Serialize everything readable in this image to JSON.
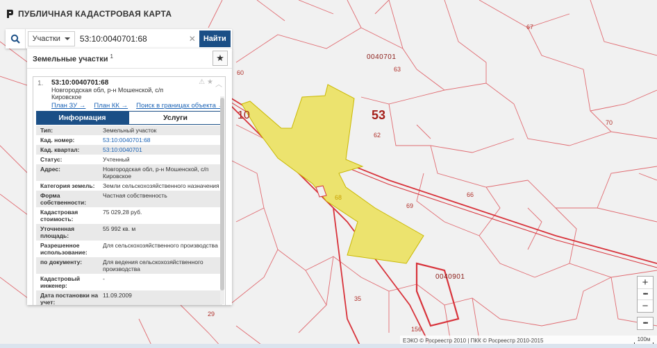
{
  "app": {
    "title": "ПУБЛИЧНАЯ КАДАСТРОВАЯ КАРТА"
  },
  "search": {
    "type_label": "Участки",
    "query": "53:10:0040701:68",
    "find_label": "Найти"
  },
  "panel": {
    "title": "Земельные участки",
    "count": "1",
    "item": {
      "index": "1.",
      "cadastral_number": "53:10:0040701:68",
      "address": "Новгородская обл, р-н Мошенской, с/п Кировское",
      "links": [
        "План ЗУ →",
        "План КК →",
        "Поиск в границах объекта →"
      ],
      "tabs": [
        "Информация",
        "Услуги"
      ],
      "rows": [
        {
          "k": "Тип:",
          "v": "Земельный участок"
        },
        {
          "k": "Кад. номер:",
          "v": "53:10:0040701:68"
        },
        {
          "k": "Кад. квартал:",
          "v": "53:10:0040701"
        },
        {
          "k": "Статус:",
          "v": "Учтенный"
        },
        {
          "k": "Адрес:",
          "v": "Новгородская обл, р-н Мошенской, с/п Кировское"
        },
        {
          "k": "Категория земель:",
          "v": "Земли сельскохозяйственного назначения"
        },
        {
          "k": "Форма собственности:",
          "v": "Частная собственность"
        },
        {
          "k": "Кадастровая стоимость:",
          "v": "75 029,28 руб."
        },
        {
          "k": "Уточненная площадь:",
          "v": "55 992 кв. м"
        },
        {
          "k": "Разрешенное использование:",
          "v": "Для сельскохозяйственного производства"
        },
        {
          "k": "по документу:",
          "v": "Для ведения сельскохозяйственного производства"
        },
        {
          "k": "Кадастровый инженер:",
          "v": "-"
        },
        {
          "k": "Дата постановки на учет:",
          "v": "11.09.2009"
        }
      ]
    }
  },
  "map": {
    "labels": [
      {
        "t": "0040701",
        "c": "zone"
      },
      {
        "t": "0040901",
        "c": "zone"
      },
      {
        "t": "53",
        "c": "big"
      },
      {
        "t": "10",
        "c": "mid"
      },
      {
        "t": "67",
        "c": ""
      },
      {
        "t": "63",
        "c": ""
      },
      {
        "t": "60",
        "c": ""
      },
      {
        "t": "62",
        "c": ""
      },
      {
        "t": "70",
        "c": ""
      },
      {
        "t": "66",
        "c": ""
      },
      {
        "t": "69",
        "c": ""
      },
      {
        "t": "68",
        "c": "yel"
      },
      {
        "t": "35",
        "c": ""
      },
      {
        "t": "29",
        "c": ""
      },
      {
        "t": "156",
        "c": ""
      }
    ],
    "parcel_color": "#ece36e",
    "boundary_color": "#d8323a"
  },
  "attribution": {
    "text": "ЕЭКО © Росреестр 2010 | ПКК © Росреестр 2010-2015",
    "scale": "100м"
  },
  "zoom": {
    "in": "+",
    "out": "−",
    "more": "•••"
  }
}
